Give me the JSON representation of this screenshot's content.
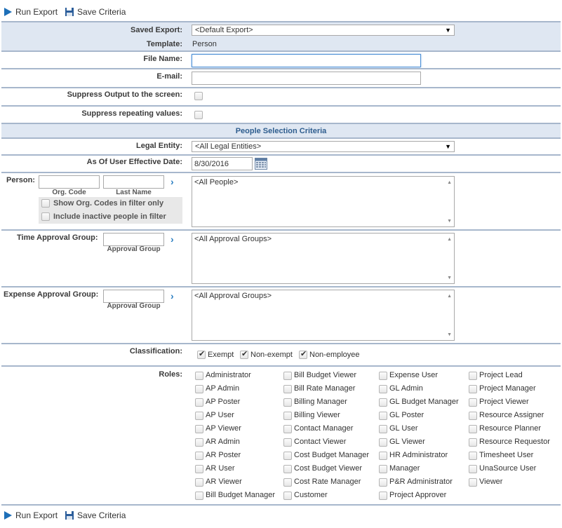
{
  "toolbar": {
    "run_export": "Run Export",
    "save_criteria": "Save Criteria"
  },
  "saved_export": {
    "label": "Saved Export:",
    "value": "<Default Export>"
  },
  "template": {
    "label": "Template:",
    "value": "Person"
  },
  "file_name": {
    "label": "File Name:",
    "value": ""
  },
  "email": {
    "label": "E-mail:",
    "value": ""
  },
  "suppress_output": {
    "label": "Suppress Output to the screen:",
    "checked": false
  },
  "suppress_repeating": {
    "label": "Suppress repeating values:",
    "checked": false
  },
  "people_section_title": "People Selection Criteria",
  "legal_entity": {
    "label": "Legal Entity:",
    "value": "<All Legal Entities>"
  },
  "effective_date": {
    "label": "As Of User Effective Date:",
    "value": "8/30/2016"
  },
  "person": {
    "label": "Person:",
    "org_code_label": "Org. Code",
    "last_name_label": "Last Name",
    "show_org_codes": "Show Org. Codes in filter only",
    "include_inactive": "Include inactive people in filter",
    "list_value": "<All People>"
  },
  "time_approval": {
    "label": "Time Approval Group:",
    "sub_label": "Approval Group",
    "list_value": "<All Approval Groups>"
  },
  "expense_approval": {
    "label": "Expense Approval Group:",
    "sub_label": "Approval Group",
    "list_value": "<All Approval Groups>"
  },
  "classification": {
    "label": "Classification:",
    "options": [
      {
        "label": "Exempt",
        "checked": true
      },
      {
        "label": "Non-exempt",
        "checked": true
      },
      {
        "label": "Non-employee",
        "checked": true
      }
    ]
  },
  "roles": {
    "label": "Roles:",
    "columns": [
      [
        "Administrator",
        "AP Admin",
        "AP Poster",
        "AP User",
        "AP Viewer",
        "AR Admin",
        "AR Poster",
        "AR User",
        "AR Viewer",
        "Bill Budget Manager"
      ],
      [
        "Bill Budget Viewer",
        "Bill Rate Manager",
        "Billing Manager",
        "Billing Viewer",
        "Contact Manager",
        "Contact Viewer",
        "Cost Budget Manager",
        "Cost Budget Viewer",
        "Cost Rate Manager",
        "Customer"
      ],
      [
        "Expense User",
        "GL Admin",
        "GL Budget Manager",
        "GL Poster",
        "GL User",
        "GL Viewer",
        "HR Administrator",
        "Manager",
        "P&R Administrator",
        "Project Approver"
      ],
      [
        "Project Lead",
        "Project Manager",
        "Project Viewer",
        "Resource Assigner",
        "Resource Planner",
        "Resource Requestor",
        "Timesheet User",
        "UnaSource User",
        "Viewer"
      ]
    ]
  }
}
